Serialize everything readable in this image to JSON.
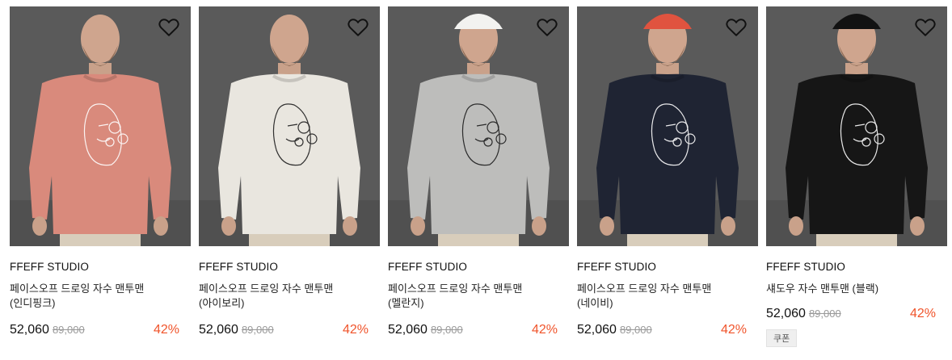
{
  "products": [
    {
      "brand": "FFEFF STUDIO",
      "name": "페이스오프 드로잉 자수 맨투맨 (인디핑크)",
      "price": "52,060",
      "original_price": "89,000",
      "discount": "42%",
      "coupon": "",
      "sweater_color": "#d98a7c",
      "hat_color": "",
      "embroidery_color": "#ffffff"
    },
    {
      "brand": "FFEFF STUDIO",
      "name": "페이스오프 드로잉 자수 맨투맨 (아이보리)",
      "price": "52,060",
      "original_price": "89,000",
      "discount": "42%",
      "coupon": "",
      "sweater_color": "#e9e6df",
      "hat_color": "",
      "embroidery_color": "#1c1c1c"
    },
    {
      "brand": "FFEFF STUDIO",
      "name": "페이스오프 드로잉 자수 맨투맨 (멜란지)",
      "price": "52,060",
      "original_price": "89,000",
      "discount": "42%",
      "coupon": "",
      "sweater_color": "#bdbdbb",
      "hat_color": "#f2f2f0",
      "embroidery_color": "#1c1c1c"
    },
    {
      "brand": "FFEFF STUDIO",
      "name": "페이스오프 드로잉 자수 맨투맨 (네이비)",
      "price": "52,060",
      "original_price": "89,000",
      "discount": "42%",
      "coupon": "",
      "sweater_color": "#1f2433",
      "hat_color": "#e0533f",
      "embroidery_color": "#ffffff"
    },
    {
      "brand": "FFEFF STUDIO",
      "name": "섀도우 자수 맨투맨 (블랙)",
      "price": "52,060",
      "original_price": "89,000",
      "discount": "42%",
      "coupon": "쿠폰",
      "sweater_color": "#161616",
      "hat_color": "#121212",
      "embroidery_color": "#ffffff"
    }
  ],
  "icons": {
    "wishlist": "heart-outline-icon"
  }
}
